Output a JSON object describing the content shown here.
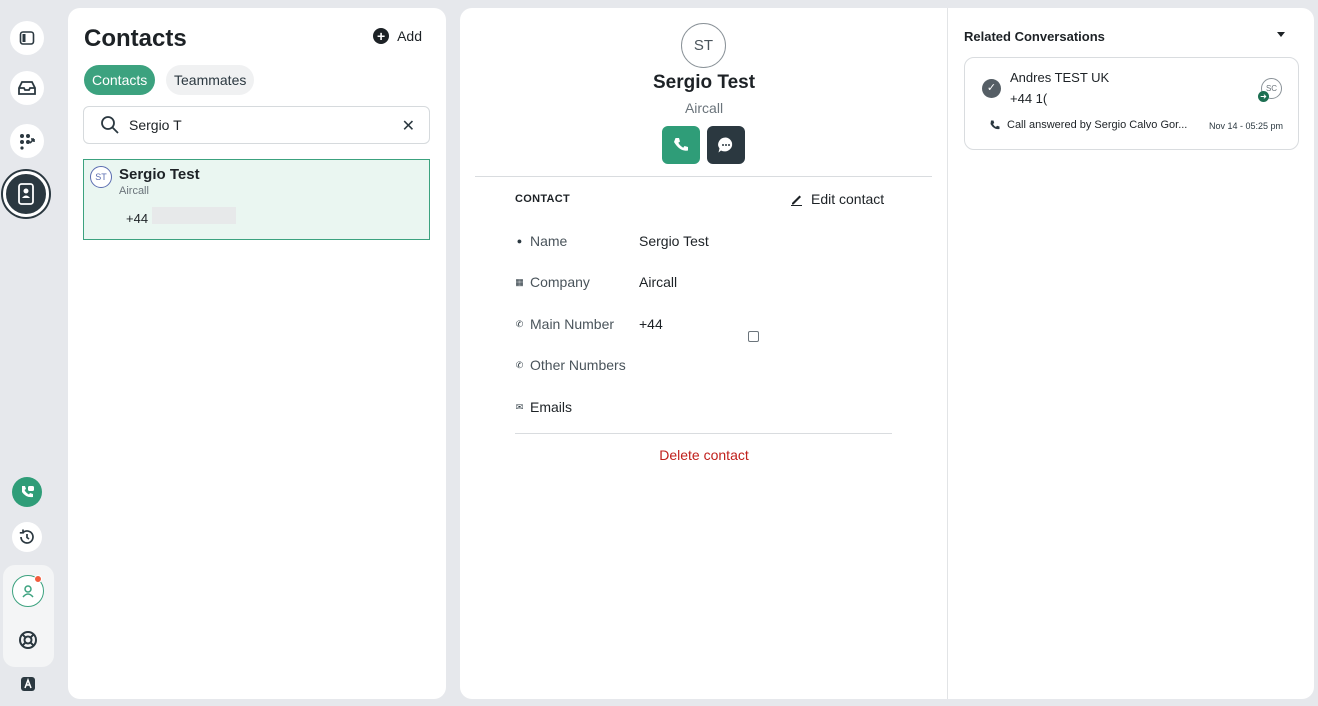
{
  "rail": {
    "items": [
      {
        "icon": "sidebar-toggle-icon"
      },
      {
        "icon": "inbox-icon"
      },
      {
        "icon": "dialer-grid-icon"
      },
      {
        "icon": "contacts-book-icon",
        "active": true
      },
      {
        "icon": "phone-chat-icon"
      },
      {
        "icon": "history-icon"
      },
      {
        "icon": "user-status-icon"
      },
      {
        "icon": "help-lifebuoy-icon"
      },
      {
        "icon": "aircall-logo-icon"
      }
    ]
  },
  "contacts_panel": {
    "title": "Contacts",
    "add_label": "Add",
    "tabs": [
      {
        "label": "Contacts",
        "active": true
      },
      {
        "label": "Teammates",
        "active": false
      }
    ],
    "search": {
      "value": "Sergio T",
      "placeholder": ""
    },
    "results": [
      {
        "initials": "ST",
        "name": "Sergio Test",
        "company": "Aircall",
        "phone": "+44"
      }
    ]
  },
  "detail": {
    "initials": "ST",
    "name": "Sergio Test",
    "company": "Aircall",
    "section_label": "CONTACT",
    "edit_label": "Edit contact",
    "fields": [
      {
        "label": "Name",
        "value": "Sergio Test",
        "icon": "person-icon"
      },
      {
        "label": "Company",
        "value": "Aircall",
        "icon": "building-icon"
      },
      {
        "label": "Main Number",
        "value": "+44",
        "icon": "phone-icon"
      },
      {
        "label": "Other Numbers",
        "value": "",
        "icon": "phone-icon"
      },
      {
        "label": "Emails",
        "value": "",
        "icon": "mail-icon"
      }
    ],
    "delete_label": "Delete contact"
  },
  "related": {
    "title": "Related Conversations",
    "items": [
      {
        "name": "Andres TEST UK",
        "phone": "+44 1(",
        "agent_initials": "SC",
        "status": "Call answered by Sergio Calvo Gor...",
        "time": "Nov 14 - 05:25 pm"
      }
    ]
  },
  "colors": {
    "accent": "#3ca27f",
    "dark": "#2b3840",
    "danger": "#c0201c"
  }
}
